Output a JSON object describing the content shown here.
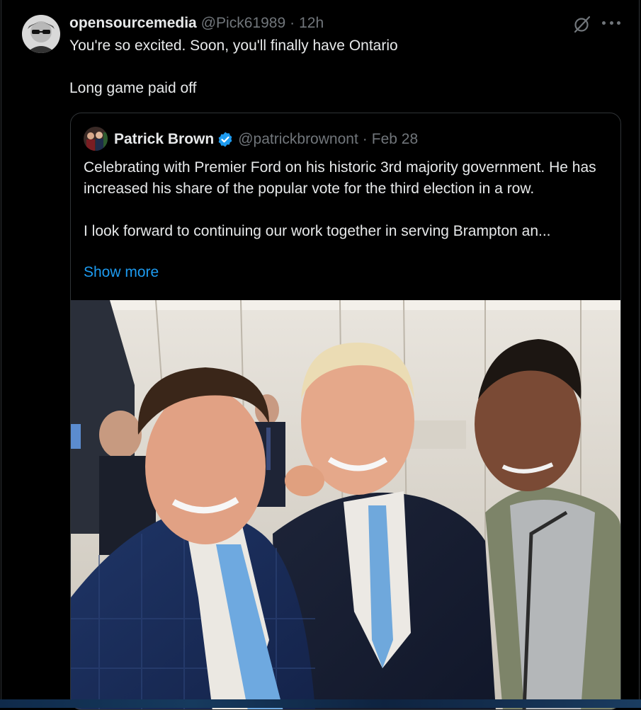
{
  "tweet": {
    "display_name": "opensourcemedia",
    "handle": "@Pick61989",
    "separator": "·",
    "time": "12h",
    "text_line1": "You're so excited. Soon, you'll finally have Ontario",
    "text_line2": "Long game paid off",
    "actions": {
      "grok_icon": "grok-icon",
      "more_icon": "more-icon"
    }
  },
  "quoted": {
    "display_name": "Patrick Brown",
    "verified": true,
    "handle": "@patrickbrownont",
    "separator": "·",
    "date": "Feb 28",
    "text_para1": "Celebrating with Premier Ford on his historic 3rd majority government. He has increased his share of the popular vote for the third election in a row.",
    "text_para2": "I look forward to continuing our work together in serving Brampton an...",
    "show_more_label": "Show more"
  },
  "colors": {
    "background": "#000000",
    "text": "#e7e9ea",
    "muted": "#71767b",
    "link": "#1d9bf0",
    "border": "#2f3336"
  }
}
